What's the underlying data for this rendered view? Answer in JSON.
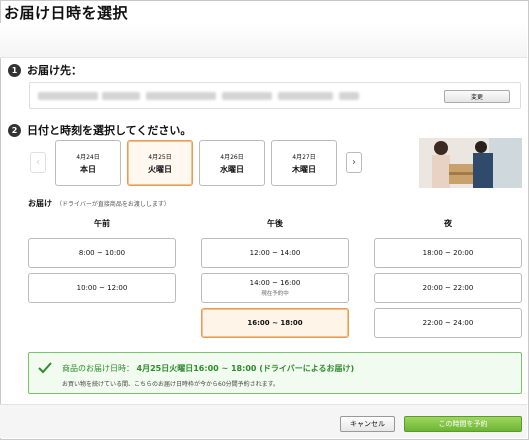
{
  "dialog": {
    "title": "お届け日時を選択"
  },
  "address_section": {
    "number": "1",
    "label": "お届け先：",
    "change_label": "変更"
  },
  "datetime_section": {
    "number": "2",
    "label": "日付と時刻を選択してください。",
    "prev_icon": "chevron-left-icon",
    "next_icon": "chevron-right-icon",
    "days": [
      {
        "date": "4月24日",
        "name": "本日",
        "selected": false
      },
      {
        "date": "4月25日",
        "name": "火曜日",
        "selected": true
      },
      {
        "date": "4月26日",
        "name": "水曜日",
        "selected": false
      },
      {
        "date": "4月27日",
        "name": "木曜日",
        "selected": false
      }
    ]
  },
  "delivery": {
    "label": "お届け",
    "note": "（ドライバーが直接商品をお渡しします）",
    "columns": [
      {
        "header": "午前",
        "slots": [
          {
            "time": "8:00 ~ 10:00"
          },
          {
            "time": "10:00 ~ 12:00"
          }
        ]
      },
      {
        "header": "午後",
        "slots": [
          {
            "time": "12:00 ~ 14:00"
          },
          {
            "time": "14:00 ~ 16:00",
            "note": "現在予約中"
          },
          {
            "time": "16:00 ~ 18:00",
            "selected": true
          }
        ]
      },
      {
        "header": "夜",
        "slots": [
          {
            "time": "18:00 ~ 20:00"
          },
          {
            "time": "20:00 ~ 22:00"
          },
          {
            "time": "22:00 ~ 24:00"
          }
        ]
      }
    ]
  },
  "confirmation": {
    "prefix": "商品のお届け日時：",
    "value": "4月25日火曜日16:00 ~ 18:00 (ドライバーによるお届け)",
    "sub": "お買い物を続けている間、こちらのお届け日時枠が今から60分間予約されます。"
  },
  "footer": {
    "cancel_label": "キャンセル",
    "reserve_label": "この時間を予約"
  },
  "colors": {
    "accent": "#e89a55",
    "confirm_green": "#2e8b2e",
    "primary_button": "#7cc13f"
  }
}
